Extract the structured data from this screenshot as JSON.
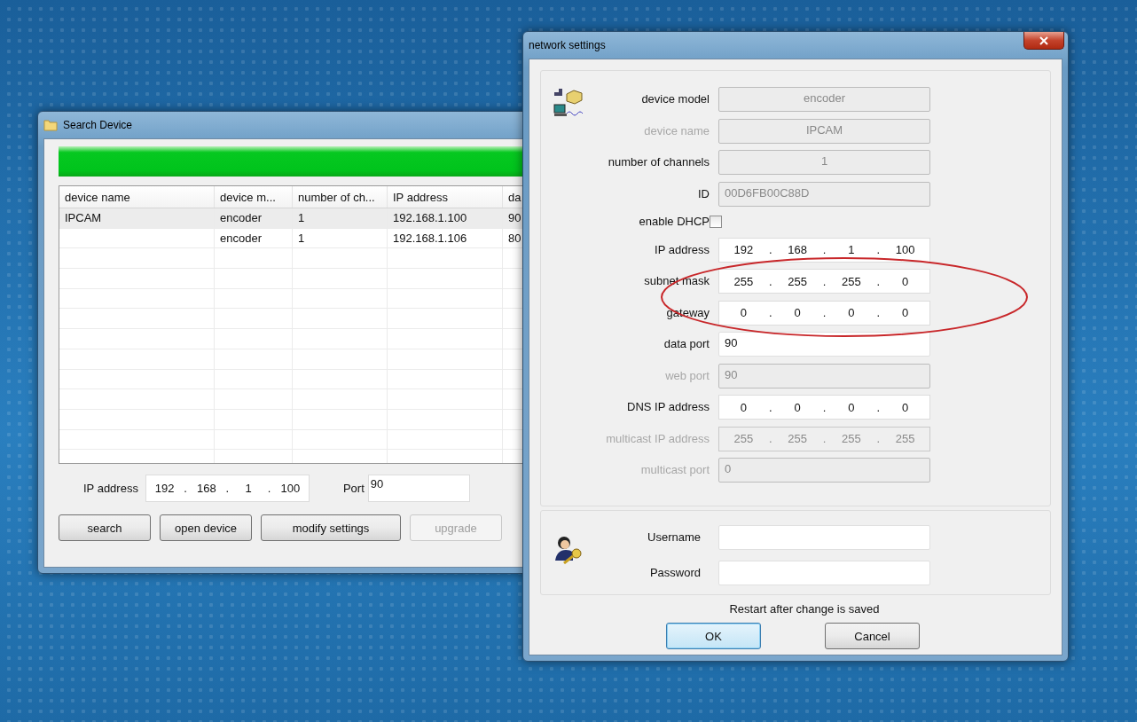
{
  "search_window": {
    "title": "Search Device",
    "progress": {
      "level": 1
    },
    "table": {
      "columns": [
        "device name",
        "device m...",
        "number of ch...",
        "IP address",
        "da"
      ],
      "rows": [
        {
          "selected": true,
          "cells": {
            "column_1": "IPCAM",
            "column_2": "encoder",
            "column_3": "1",
            "column_4": "192.168.1.100",
            "column_5": "90"
          }
        },
        {
          "selected": false,
          "cells": {
            "column_2": "encoder",
            "column_3": "1",
            "column_4": "192.168.1.106",
            "column_5": "80"
          }
        }
      ]
    },
    "ip_field": {
      "label": "IP address",
      "octets": [
        "192",
        "168",
        "1",
        "100"
      ],
      "separator": "."
    },
    "port_field": {
      "label": "Port",
      "value": "90"
    },
    "buttons": [
      {
        "label": "search",
        "disabled": false
      },
      {
        "label": "open device",
        "disabled": false
      },
      {
        "label": "modify settings",
        "disabled": false
      },
      {
        "label": "upgrade",
        "disabled": true
      }
    ]
  },
  "settings_dialog": {
    "title": "network settings",
    "fields": [
      {
        "kind": "text",
        "label": "device model",
        "value": "encoder",
        "disabled": true,
        "label_dimmed": false,
        "centered": true,
        "circled": false
      },
      {
        "kind": "text",
        "label": "device name",
        "value": "IPCAM",
        "disabled": true,
        "label_dimmed": true,
        "centered": true,
        "circled": false
      },
      {
        "kind": "text",
        "label": "number of channels",
        "value": "1",
        "disabled": true,
        "label_dimmed": false,
        "centered": true,
        "circled": false
      },
      {
        "kind": "text",
        "label": "ID",
        "value": "00D6FB00C88D",
        "disabled": true,
        "label_dimmed": false,
        "centered": false,
        "circled": false
      },
      {
        "kind": "checkbox",
        "label": "enable DHCP",
        "checked": false
      },
      {
        "kind": "ip",
        "label": "IP address",
        "octets": [
          "192",
          "168",
          "1",
          "100"
        ],
        "separator": ".",
        "disabled": false,
        "label_dimmed": false,
        "circled": false
      },
      {
        "kind": "ip",
        "label": "subnet mask",
        "octets": [
          "255",
          "255",
          "255",
          "0"
        ],
        "separator": ".",
        "disabled": false,
        "label_dimmed": false,
        "circled": true
      },
      {
        "kind": "ip",
        "label": "gateway",
        "octets": [
          "0",
          "0",
          "0",
          "0"
        ],
        "separator": ".",
        "disabled": false,
        "label_dimmed": false,
        "circled": true
      },
      {
        "kind": "text",
        "label": "data port",
        "value": "90",
        "disabled": false,
        "label_dimmed": false,
        "centered": false,
        "circled": false
      },
      {
        "kind": "text",
        "label": "web port",
        "value": "90",
        "disabled": true,
        "label_dimmed": true,
        "centered": false,
        "circled": false
      },
      {
        "kind": "ip",
        "label": "DNS IP address",
        "octets": [
          "0",
          "0",
          "0",
          "0"
        ],
        "separator": ".",
        "disabled": false,
        "label_dimmed": false,
        "circled": false
      },
      {
        "kind": "ip",
        "label": "multicast IP address",
        "octets": [
          "255",
          "255",
          "255",
          "255"
        ],
        "separator": ".",
        "disabled": true,
        "label_dimmed": true,
        "circled": false
      },
      {
        "kind": "text",
        "label": "multicast port",
        "value": "0",
        "disabled": true,
        "label_dimmed": true,
        "centered": false,
        "circled": false
      }
    ],
    "login": [
      {
        "label": "Username"
      },
      {
        "label": "Password"
      }
    ],
    "note": "Restart after change is saved",
    "buttons": [
      {
        "label": "OK",
        "default": true
      },
      {
        "label": "Cancel",
        "default": false
      }
    ]
  }
}
